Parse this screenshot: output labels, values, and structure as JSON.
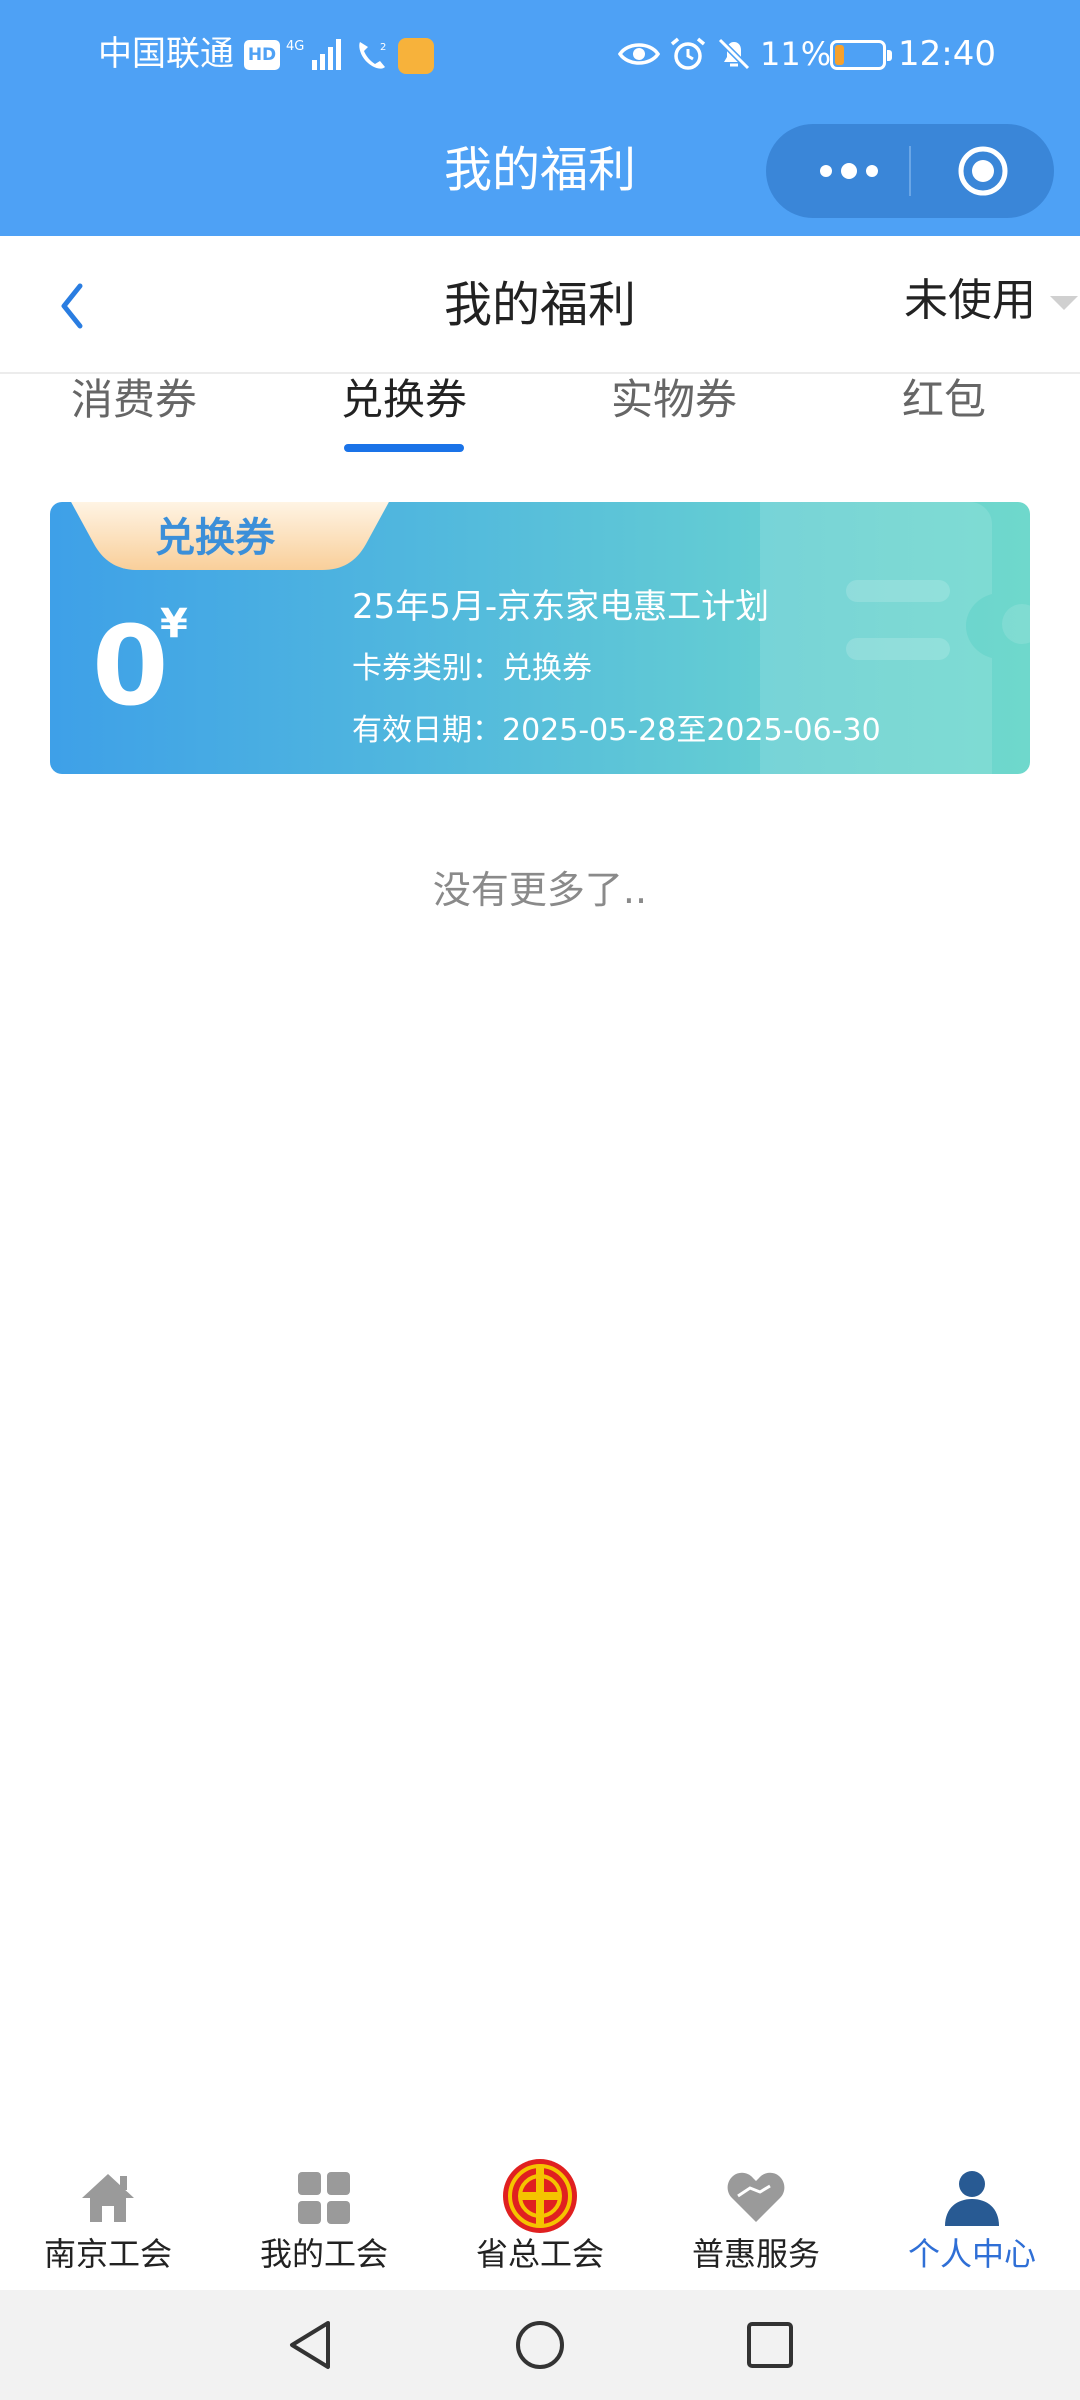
{
  "status_bar": {
    "carrier": "中国联通",
    "hd_badge": "HD",
    "battery_percent": "11%",
    "battery_level": 0.11,
    "time": "12:40"
  },
  "mini_program": {
    "title": "我的福利"
  },
  "header": {
    "title": "我的福利",
    "filter_label": "未使用"
  },
  "tabs": [
    {
      "label": "消费券",
      "active": false
    },
    {
      "label": "兑换券",
      "active": true
    },
    {
      "label": "实物券",
      "active": false
    },
    {
      "label": "红包",
      "active": false
    }
  ],
  "coupon": {
    "tag": "兑换券",
    "amount": "0",
    "currency": "¥",
    "title": "25年5月-京东家电惠工计划",
    "type_line": "卡券类别：兑换券",
    "validity_line": "有效日期：2025-05-28至2025-06-30"
  },
  "list_end_text": "没有更多了..",
  "bottom_nav": [
    {
      "label": "南京工会",
      "icon": "home-icon",
      "active": false
    },
    {
      "label": "我的工会",
      "icon": "grid-icon",
      "active": false
    },
    {
      "label": "省总工会",
      "icon": "union-emblem-icon",
      "active": false
    },
    {
      "label": "普惠服务",
      "icon": "heart-hand-icon",
      "active": false
    },
    {
      "label": "个人中心",
      "icon": "person-icon",
      "active": true
    }
  ],
  "colors": {
    "title_bar": "#4ea1f5",
    "accent": "#1a73e8",
    "active_nav": "#2f6fd6"
  }
}
